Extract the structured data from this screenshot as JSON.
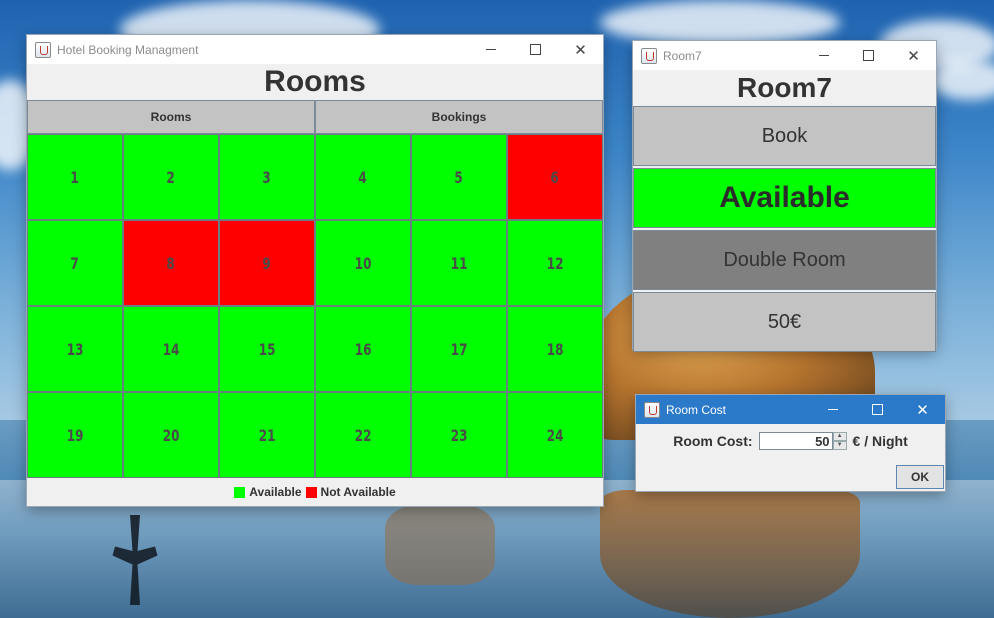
{
  "colors": {
    "available": "#00ff00",
    "not_available": "#ff0000",
    "tab_bg": "#c3c3c3",
    "room_type_bg": "#808080",
    "active_title": "#2b79c9"
  },
  "main_window": {
    "title": "Hotel Booking Managment",
    "heading": "Rooms",
    "tabs": [
      "Rooms",
      "Bookings"
    ],
    "rooms": [
      {
        "number": "1",
        "status": "available"
      },
      {
        "number": "2",
        "status": "available"
      },
      {
        "number": "3",
        "status": "available"
      },
      {
        "number": "4",
        "status": "available"
      },
      {
        "number": "5",
        "status": "available"
      },
      {
        "number": "6",
        "status": "not_available"
      },
      {
        "number": "7",
        "status": "available"
      },
      {
        "number": "8",
        "status": "not_available"
      },
      {
        "number": "9",
        "status": "not_available"
      },
      {
        "number": "10",
        "status": "available"
      },
      {
        "number": "11",
        "status": "available"
      },
      {
        "number": "12",
        "status": "available"
      },
      {
        "number": "13",
        "status": "available"
      },
      {
        "number": "14",
        "status": "available"
      },
      {
        "number": "15",
        "status": "available"
      },
      {
        "number": "16",
        "status": "available"
      },
      {
        "number": "17",
        "status": "available"
      },
      {
        "number": "18",
        "status": "available"
      },
      {
        "number": "19",
        "status": "available"
      },
      {
        "number": "20",
        "status": "available"
      },
      {
        "number": "21",
        "status": "available"
      },
      {
        "number": "22",
        "status": "available"
      },
      {
        "number": "23",
        "status": "available"
      },
      {
        "number": "24",
        "status": "available"
      }
    ],
    "legend": {
      "available": "Available",
      "not_available": "Not Available"
    }
  },
  "room_window": {
    "title": "Room7",
    "heading": "Room7",
    "book_label": "Book",
    "status_label": "Available",
    "room_type": "Double Room",
    "price": "50€"
  },
  "cost_dialog": {
    "title": "Room Cost",
    "label": "Room Cost:",
    "value": "50",
    "unit": "€ / Night",
    "ok_label": "OK"
  },
  "window_controls": {
    "close_glyph": "✕"
  }
}
